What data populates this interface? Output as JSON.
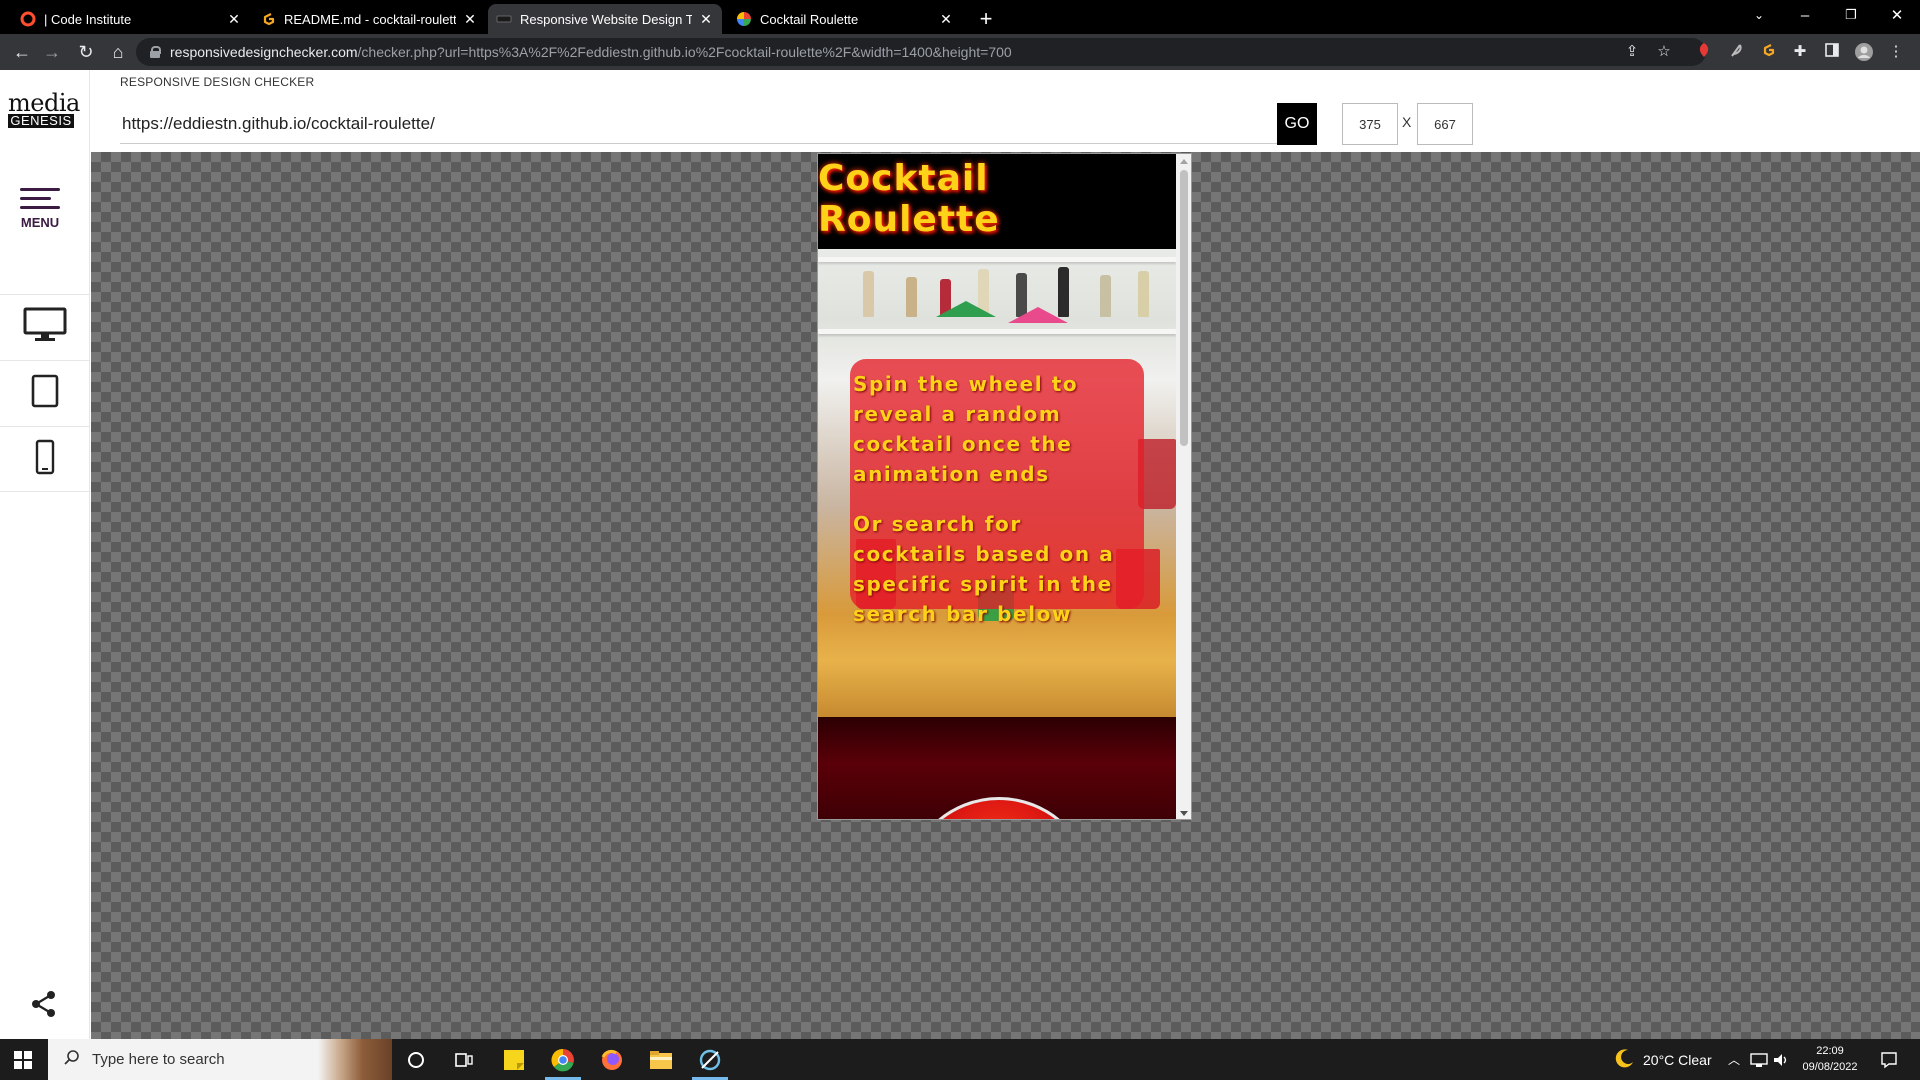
{
  "browser": {
    "tabs": [
      {
        "label": "| Code Institute",
        "icon": "code-institute-icon",
        "active": false
      },
      {
        "label": "README.md - cocktail-roulette -",
        "icon": "gitpod-icon",
        "active": false
      },
      {
        "label": "Responsive Website Design Teste",
        "icon": "rdc-icon",
        "active": true
      },
      {
        "label": "Cocktail Roulette",
        "icon": "cocktail-roulette-icon",
        "active": false
      }
    ],
    "url_host": "responsivedesignchecker.com",
    "url_path": "/checker.php?url=https%3A%2F%2Feddiestn.github.io%2Fcocktail-roulette%2F&width=1400&height=700"
  },
  "sidebar": {
    "logo_top": "media",
    "logo_bottom": "GENESIS",
    "menu_label": "MENU",
    "devices": [
      "desktop-icon",
      "tablet-icon",
      "mobile-icon"
    ]
  },
  "checker": {
    "title": "RESPONSIVE DESIGN CHECKER",
    "url_value": "https://eddiestn.github.io/cocktail-roulette/",
    "go_label": "GO",
    "width_value": "375",
    "x_label": "X",
    "height_value": "667"
  },
  "site": {
    "title": "Cocktail Roulette",
    "intro_line1": "Spin the wheel to reveal a random cocktail once the animation ends",
    "intro_line2": "Or search for cocktails based on a specific spirit in the search bar below"
  },
  "taskbar": {
    "search_placeholder": "Type here to search",
    "weather": "20°C  Clear",
    "time": "22:09",
    "date": "09/08/2022"
  },
  "colors": {
    "accent_purple": "#3b1a43",
    "site_title_yellow": "#ffd21a",
    "overlay_red": "#e61e28"
  }
}
